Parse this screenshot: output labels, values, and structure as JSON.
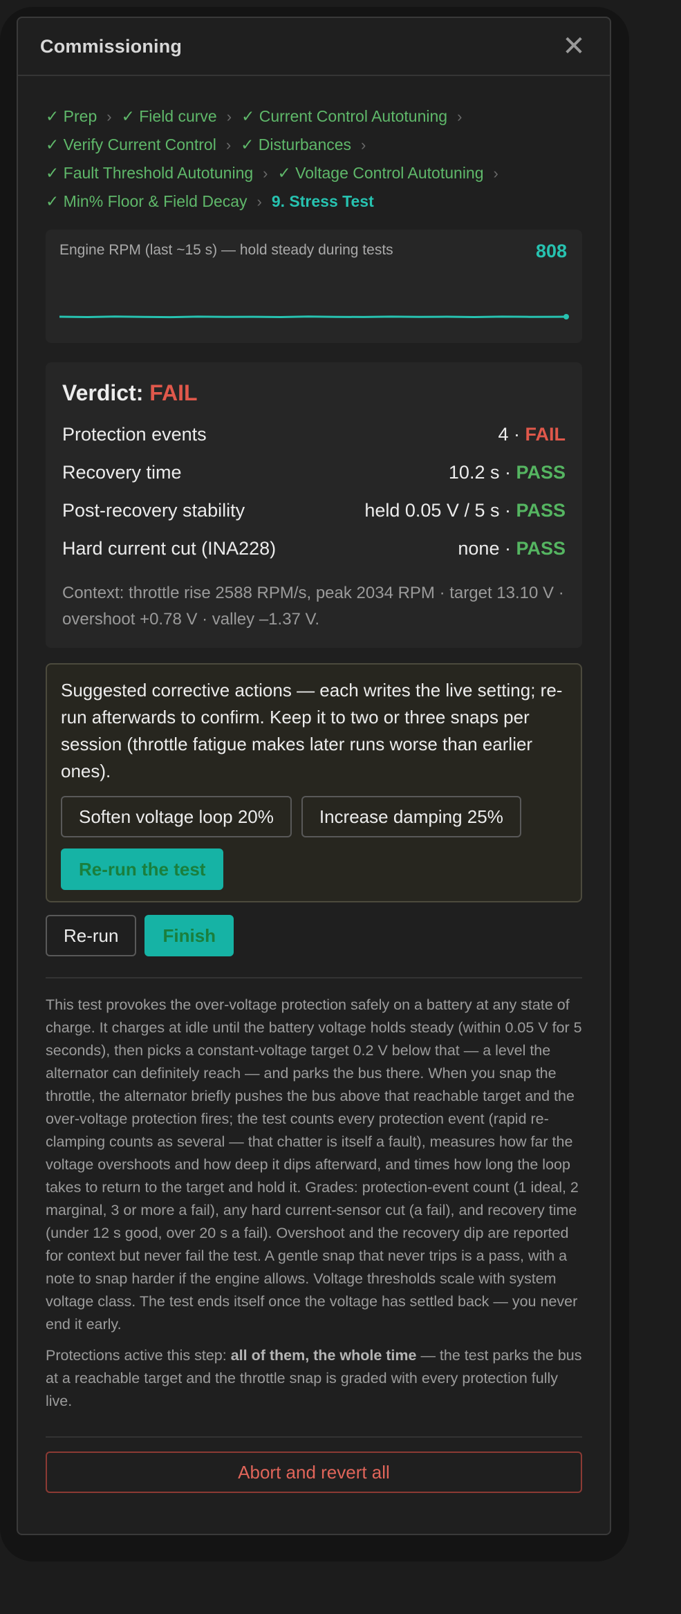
{
  "modal": {
    "title": "Commissioning",
    "close_symbol": "✕"
  },
  "steps": {
    "rows": [
      [
        "✓ Prep",
        "✓ Field curve",
        "✓ Current Control Autotuning"
      ],
      [
        "✓ Verify Current Control",
        "✓ Disturbances"
      ],
      [
        "✓ Fault Threshold Autotuning",
        "✓ Voltage Control Autotuning"
      ],
      [
        "✓ Min% Floor & Field Decay",
        "9. Stress Test"
      ]
    ],
    "separator": "›",
    "current": "9. Stress Test"
  },
  "rpm": {
    "label": "Engine RPM (last ~15 s) — hold steady during tests",
    "value": "808",
    "line_color": "#27c2b0"
  },
  "verdict": {
    "label": "Verdict:",
    "status": "FAIL",
    "rows": [
      {
        "name": "Protection events",
        "value": "4 ·",
        "grade": "FAIL"
      },
      {
        "name": "Recovery time",
        "value": "10.2 s ·",
        "grade": "PASS"
      },
      {
        "name": "Post-recovery stability",
        "value": "held 0.05 V / 5 s ·",
        "grade": "PASS"
      },
      {
        "name": "Hard current cut (INA228)",
        "value": "none ·",
        "grade": "PASS"
      }
    ],
    "context": "Context: throttle rise 2588 RPM/s, peak 2034 RPM · target 13.10 V · overshoot +0.78 V · valley –1.37 V."
  },
  "suggestions": {
    "text": "Suggested corrective actions — each writes the live setting; re-run afterwards to confirm. Keep it to two or three snaps per session (throttle fatigue makes later runs worse than earlier ones).",
    "soften_label": "Soften voltage loop 20%",
    "damping_label": "Increase damping 25%",
    "rerun_test_label": "Re-run the test"
  },
  "actions": {
    "rerun_label": "Re-run",
    "finish_label": "Finish"
  },
  "description": {
    "main": "This test provokes the over-voltage protection safely on a battery at any state of charge. It charges at idle until the battery voltage holds steady (within 0.05 V for 5 seconds), then picks a constant-voltage target 0.2 V below that — a level the alternator can definitely reach — and parks the bus there. When you snap the throttle, the alternator briefly pushes the bus above that reachable target and the over-voltage protection fires; the test counts every protection event (rapid re-clamping counts as several — that chatter is itself a fault), measures how far the voltage overshoots and how deep it dips afterward, and times how long the loop takes to return to the target and hold it. Grades: protection-event count (1 ideal, 2 marginal, 3 or more a fail), any hard current-sensor cut (a fail), and recovery time (under 12 s good, over 20 s a fail). Overshoot and the recovery dip are reported for context but never fail the test. A gentle snap that never trips is a pass, with a note to snap harder if the engine allows. Voltage thresholds scale with system voltage class. The test ends itself once the voltage has settled back — you never end it early.",
    "protections_prefix": "Protections active this step: ",
    "protections_bold": "all of them, the whole time",
    "protections_suffix": " — the test parks the bus at a reachable target and the throttle snap is graded with every protection fully live."
  },
  "abort": {
    "label": "Abort and revert all"
  }
}
